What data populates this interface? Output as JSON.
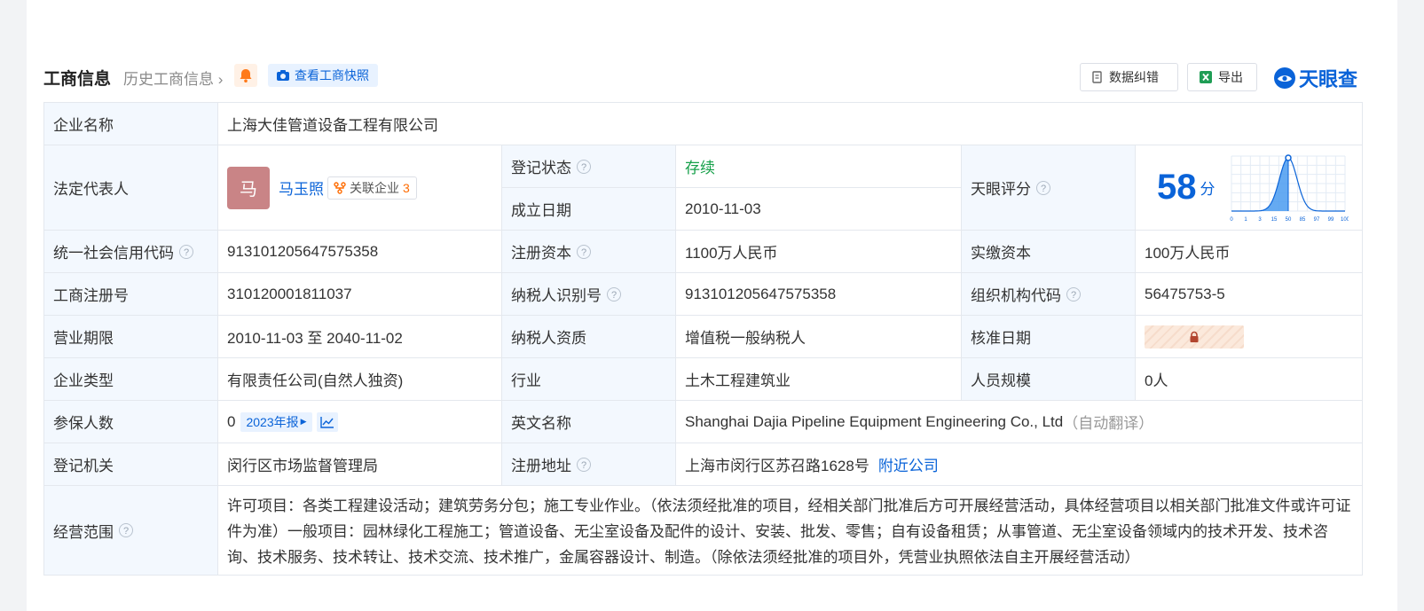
{
  "header": {
    "title": "工商信息",
    "history": "历史工商信息",
    "snapshot_label": "查看工商快照",
    "correction_label": "数据纠错",
    "export_label": "导出",
    "logo_text": "天眼查"
  },
  "rows": {
    "company_name_label": "企业名称",
    "company_name": "上海大佳管道设备工程有限公司",
    "legal_rep_label": "法定代表人",
    "legal_rep_avatar": "马",
    "legal_rep_name": "马玉照",
    "assoc_label": "关联企业",
    "assoc_count": "3",
    "reg_status_label": "登记状态",
    "reg_status": "存续",
    "founded_label": "成立日期",
    "founded": "2010-11-03",
    "score_label": "天眼评分",
    "score": "58",
    "score_unit": "分",
    "credit_code_label": "统一社会信用代码",
    "credit_code": "913101205647575358",
    "reg_capital_label": "注册资本",
    "reg_capital": "1100万人民币",
    "paid_capital_label": "实缴资本",
    "paid_capital": "100万人民币",
    "reg_no_label": "工商注册号",
    "reg_no": "310120001811037",
    "taxpayer_id_label": "纳税人识别号",
    "taxpayer_id": "913101205647575358",
    "org_code_label": "组织机构代码",
    "org_code": "56475753-5",
    "term_label": "营业期限",
    "term": "2010-11-03 至 2040-11-02",
    "taxpayer_qual_label": "纳税人资质",
    "taxpayer_qual": "增值税一般纳税人",
    "approval_date_label": "核准日期",
    "type_label": "企业类型",
    "type": "有限责任公司(自然人独资)",
    "industry_label": "行业",
    "industry": "土木工程建筑业",
    "staff_label": "人员规模",
    "staff": "0人",
    "insured_label": "参保人数",
    "insured": "0",
    "report_label": "2023年报",
    "english_name_label": "英文名称",
    "english_name": "Shanghai Dajia Pipeline Equipment Engineering Co., Ltd",
    "auto_translate": "（自动翻译）",
    "authority_label": "登记机关",
    "authority": "闵行区市场监督管理局",
    "address_label": "注册地址",
    "address": "上海市闵行区苏召路1628号",
    "nearby_label": "附近公司",
    "scope_label": "经营范围",
    "scope": "许可项目：各类工程建设活动；建筑劳务分包；施工专业作业。（依法须经批准的项目，经相关部门批准后方可开展经营活动，具体经营项目以相关部门批准文件或许可证件为准）一般项目：园林绿化工程施工；管道设备、无尘室设备及配件的设计、安装、批发、零售；自有设备租赁；从事管道、无尘室设备领域内的技术开发、技术咨询、技术服务、技术转让、技术交流、技术推广，金属容器设计、制造。（除依法须经批准的项目外，凭营业执照依法自主开展经营活动）"
  },
  "score_chart": {
    "ticks": [
      "0",
      "1",
      "3",
      "15",
      "50",
      "85",
      "97",
      "99",
      "100"
    ],
    "marker_value": 50
  },
  "colors": {
    "accent": "#0a63d8",
    "status_green": "#16a04a",
    "label_bg": "#f3f8fe"
  }
}
